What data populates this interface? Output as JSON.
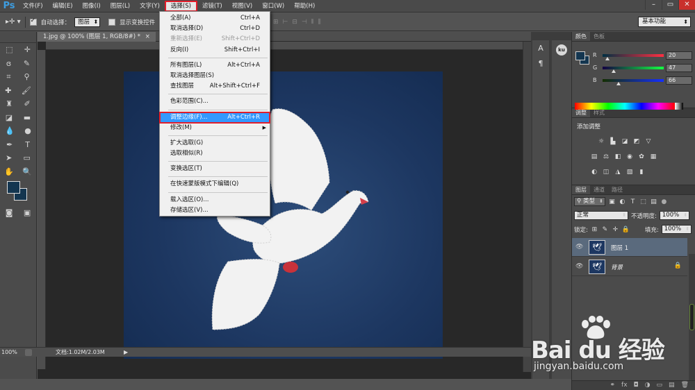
{
  "app": {
    "logo": "Ps"
  },
  "menubar": {
    "items": [
      "文件(F)",
      "编辑(E)",
      "图像(I)",
      "图层(L)",
      "文字(Y)",
      "选择(S)",
      "滤镜(T)",
      "视图(V)",
      "窗口(W)",
      "帮助(H)"
    ],
    "active_index": 5
  },
  "window_controls": {
    "minimize": "–",
    "restore": "▭",
    "close": "✕"
  },
  "options": {
    "auto_select_label": "自动选择：",
    "auto_select_value": "图层",
    "show_transform_label": "显示变换控件",
    "workspace": "基本功能"
  },
  "document": {
    "tab_title": "1.jpg @ 100% (图层 1, RGB/8#) *",
    "tab_close": "×",
    "zoom": "100%",
    "doc_size": "文档:1.02M/2.03M"
  },
  "select_menu": {
    "items": [
      {
        "label": "全部(A)",
        "shortcut": "Ctrl+A"
      },
      {
        "label": "取消选择(D)",
        "shortcut": "Ctrl+D"
      },
      {
        "label": "重新选择(E)",
        "shortcut": "Shift+Ctrl+D",
        "disabled": true
      },
      {
        "label": "反向(I)",
        "shortcut": "Shift+Ctrl+I"
      },
      {
        "sep": true
      },
      {
        "label": "所有图层(L)",
        "shortcut": "Alt+Ctrl+A"
      },
      {
        "label": "取消选择图层(S)",
        "shortcut": ""
      },
      {
        "label": "查找图层",
        "shortcut": "Alt+Shift+Ctrl+F"
      },
      {
        "sep": true
      },
      {
        "label": "色彩范围(C)...",
        "shortcut": ""
      },
      {
        "sep": true
      },
      {
        "label": "调整边缘(F)...",
        "shortcut": "Alt+Ctrl+R",
        "highlight": true
      },
      {
        "label": "修改(M)",
        "shortcut": "",
        "submenu": true
      },
      {
        "sep": true
      },
      {
        "label": "扩大选取(G)",
        "shortcut": ""
      },
      {
        "label": "选取相似(R)",
        "shortcut": ""
      },
      {
        "sep": true
      },
      {
        "label": "变换选区(T)",
        "shortcut": ""
      },
      {
        "sep": true
      },
      {
        "label": "在快速蒙版模式下编辑(Q)",
        "shortcut": ""
      },
      {
        "sep": true
      },
      {
        "label": "载入选区(O)...",
        "shortcut": ""
      },
      {
        "label": "存储选区(V)...",
        "shortcut": ""
      }
    ]
  },
  "color_panel": {
    "tabs": [
      "颜色",
      "色板"
    ],
    "r_label": "R",
    "g_label": "G",
    "b_label": "B",
    "r": "20",
    "g": "47",
    "b": "66",
    "r_level": 0.078,
    "g_level": 0.184,
    "b_level": 0.259,
    "foreground_color": "#142F42"
  },
  "adjust_panel": {
    "tabs": [
      "调整",
      "样式"
    ],
    "title": "添加调整"
  },
  "layers_panel": {
    "tabs": [
      "图层",
      "通道",
      "路径"
    ],
    "filter_label": "类型",
    "blend_mode": "正常",
    "opacity_label": "不透明度:",
    "opacity": "100%",
    "lock_label": "锁定:",
    "fill_label": "填充:",
    "fill": "100%",
    "layers": [
      {
        "name": "图层 1",
        "selected": true,
        "locked": false,
        "italic": false
      },
      {
        "name": "背景",
        "selected": false,
        "locked": true,
        "italic": true
      }
    ],
    "footer_icons": [
      "⚭",
      "fx",
      "◘",
      "◑",
      "▭",
      "▤",
      "🗑"
    ]
  },
  "watermark": {
    "main": "Bai du 经验",
    "sub": "jingyan.baidu.com"
  }
}
